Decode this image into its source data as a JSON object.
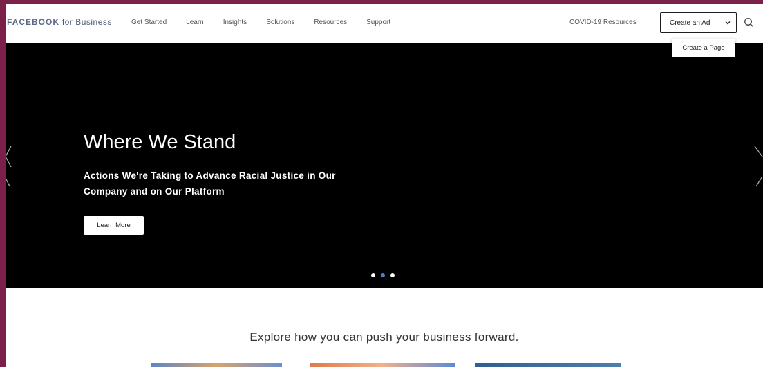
{
  "header": {
    "logo_brand": "FACEBOOK",
    "logo_suffix": " for Business",
    "nav": [
      {
        "label": "Get Started"
      },
      {
        "label": "Learn"
      },
      {
        "label": "Insights"
      },
      {
        "label": "Solutions"
      },
      {
        "label": "Resources"
      },
      {
        "label": "Support"
      }
    ],
    "covid_link": "COVID-19 Resources",
    "create_ad_label": "Create an Ad",
    "dropdown_item": "Create a Page"
  },
  "hero": {
    "title": "Where We Stand",
    "subtitle": "Actions We're Taking to Advance Racial Justice in Our Company and on Our Platform",
    "button_label": "Learn More",
    "slide_count": 3,
    "active_slide": 2
  },
  "explore": {
    "heading": "Explore how you can push your business forward."
  },
  "colors": {
    "frame": "#7a2049",
    "hero_bg": "#000000",
    "active_dot": "#4a7fd6"
  }
}
